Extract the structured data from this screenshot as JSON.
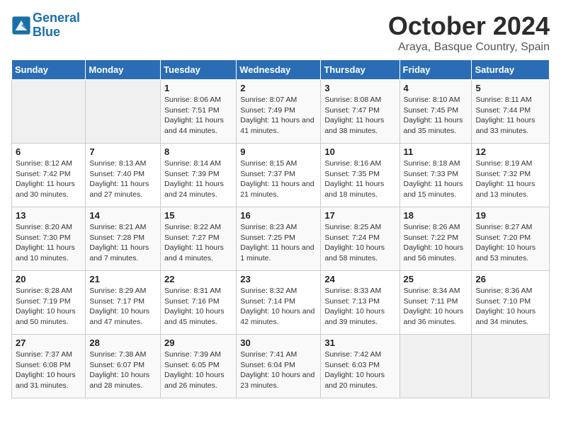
{
  "header": {
    "logo_line1": "General",
    "logo_line2": "Blue",
    "month": "October 2024",
    "location": "Araya, Basque Country, Spain"
  },
  "columns": [
    "Sunday",
    "Monday",
    "Tuesday",
    "Wednesday",
    "Thursday",
    "Friday",
    "Saturday"
  ],
  "weeks": [
    {
      "days": [
        {
          "num": "",
          "info": ""
        },
        {
          "num": "",
          "info": ""
        },
        {
          "num": "1",
          "info": "Sunrise: 8:06 AM\nSunset: 7:51 PM\nDaylight: 11 hours and 44 minutes."
        },
        {
          "num": "2",
          "info": "Sunrise: 8:07 AM\nSunset: 7:49 PM\nDaylight: 11 hours and 41 minutes."
        },
        {
          "num": "3",
          "info": "Sunrise: 8:08 AM\nSunset: 7:47 PM\nDaylight: 11 hours and 38 minutes."
        },
        {
          "num": "4",
          "info": "Sunrise: 8:10 AM\nSunset: 7:45 PM\nDaylight: 11 hours and 35 minutes."
        },
        {
          "num": "5",
          "info": "Sunrise: 8:11 AM\nSunset: 7:44 PM\nDaylight: 11 hours and 33 minutes."
        }
      ]
    },
    {
      "days": [
        {
          "num": "6",
          "info": "Sunrise: 8:12 AM\nSunset: 7:42 PM\nDaylight: 11 hours and 30 minutes."
        },
        {
          "num": "7",
          "info": "Sunrise: 8:13 AM\nSunset: 7:40 PM\nDaylight: 11 hours and 27 minutes."
        },
        {
          "num": "8",
          "info": "Sunrise: 8:14 AM\nSunset: 7:39 PM\nDaylight: 11 hours and 24 minutes."
        },
        {
          "num": "9",
          "info": "Sunrise: 8:15 AM\nSunset: 7:37 PM\nDaylight: 11 hours and 21 minutes."
        },
        {
          "num": "10",
          "info": "Sunrise: 8:16 AM\nSunset: 7:35 PM\nDaylight: 11 hours and 18 minutes."
        },
        {
          "num": "11",
          "info": "Sunrise: 8:18 AM\nSunset: 7:33 PM\nDaylight: 11 hours and 15 minutes."
        },
        {
          "num": "12",
          "info": "Sunrise: 8:19 AM\nSunset: 7:32 PM\nDaylight: 11 hours and 13 minutes."
        }
      ]
    },
    {
      "days": [
        {
          "num": "13",
          "info": "Sunrise: 8:20 AM\nSunset: 7:30 PM\nDaylight: 11 hours and 10 minutes."
        },
        {
          "num": "14",
          "info": "Sunrise: 8:21 AM\nSunset: 7:28 PM\nDaylight: 11 hours and 7 minutes."
        },
        {
          "num": "15",
          "info": "Sunrise: 8:22 AM\nSunset: 7:27 PM\nDaylight: 11 hours and 4 minutes."
        },
        {
          "num": "16",
          "info": "Sunrise: 8:23 AM\nSunset: 7:25 PM\nDaylight: 11 hours and 1 minute."
        },
        {
          "num": "17",
          "info": "Sunrise: 8:25 AM\nSunset: 7:24 PM\nDaylight: 10 hours and 58 minutes."
        },
        {
          "num": "18",
          "info": "Sunrise: 8:26 AM\nSunset: 7:22 PM\nDaylight: 10 hours and 56 minutes."
        },
        {
          "num": "19",
          "info": "Sunrise: 8:27 AM\nSunset: 7:20 PM\nDaylight: 10 hours and 53 minutes."
        }
      ]
    },
    {
      "days": [
        {
          "num": "20",
          "info": "Sunrise: 8:28 AM\nSunset: 7:19 PM\nDaylight: 10 hours and 50 minutes."
        },
        {
          "num": "21",
          "info": "Sunrise: 8:29 AM\nSunset: 7:17 PM\nDaylight: 10 hours and 47 minutes."
        },
        {
          "num": "22",
          "info": "Sunrise: 8:31 AM\nSunset: 7:16 PM\nDaylight: 10 hours and 45 minutes."
        },
        {
          "num": "23",
          "info": "Sunrise: 8:32 AM\nSunset: 7:14 PM\nDaylight: 10 hours and 42 minutes."
        },
        {
          "num": "24",
          "info": "Sunrise: 8:33 AM\nSunset: 7:13 PM\nDaylight: 10 hours and 39 minutes."
        },
        {
          "num": "25",
          "info": "Sunrise: 8:34 AM\nSunset: 7:11 PM\nDaylight: 10 hours and 36 minutes."
        },
        {
          "num": "26",
          "info": "Sunrise: 8:36 AM\nSunset: 7:10 PM\nDaylight: 10 hours and 34 minutes."
        }
      ]
    },
    {
      "days": [
        {
          "num": "27",
          "info": "Sunrise: 7:37 AM\nSunset: 6:08 PM\nDaylight: 10 hours and 31 minutes."
        },
        {
          "num": "28",
          "info": "Sunrise: 7:38 AM\nSunset: 6:07 PM\nDaylight: 10 hours and 28 minutes."
        },
        {
          "num": "29",
          "info": "Sunrise: 7:39 AM\nSunset: 6:05 PM\nDaylight: 10 hours and 26 minutes."
        },
        {
          "num": "30",
          "info": "Sunrise: 7:41 AM\nSunset: 6:04 PM\nDaylight: 10 hours and 23 minutes."
        },
        {
          "num": "31",
          "info": "Sunrise: 7:42 AM\nSunset: 6:03 PM\nDaylight: 10 hours and 20 minutes."
        },
        {
          "num": "",
          "info": ""
        },
        {
          "num": "",
          "info": ""
        }
      ]
    }
  ]
}
